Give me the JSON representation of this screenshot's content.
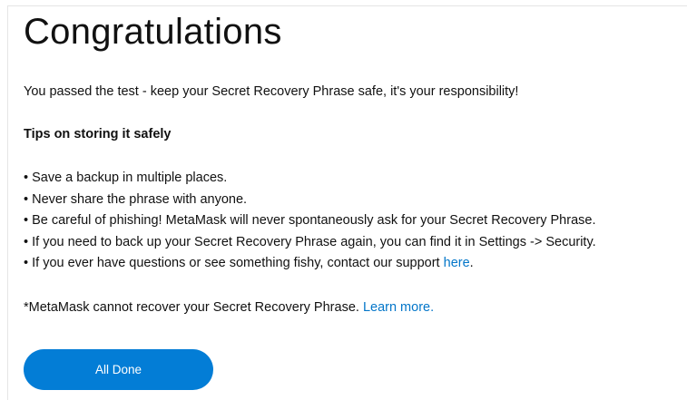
{
  "title": "Congratulations",
  "intro": "You passed the test - keep your Secret Recovery Phrase safe, it's your responsibility!",
  "tips": {
    "heading": "Tips on storing it safely",
    "items": [
      "• Save a backup in multiple places.",
      "• Never share the phrase with anyone.",
      "• Be careful of phishing! MetaMask will never spontaneously ask for your Secret Recovery Phrase.",
      "• If you need to back up your Secret Recovery Phrase again, you can find it in Settings -> Security."
    ],
    "support_text": "• If you ever have questions or see something fishy, contact our support ",
    "support_link": "here",
    "support_end": "."
  },
  "disclaimer": {
    "text": "*MetaMask cannot recover your Secret Recovery Phrase. ",
    "link": "Learn more."
  },
  "button": {
    "label": "All Done"
  },
  "colors": {
    "link": "#0376c9",
    "button_bg": "#037dd6",
    "button_text": "#ffffff"
  }
}
